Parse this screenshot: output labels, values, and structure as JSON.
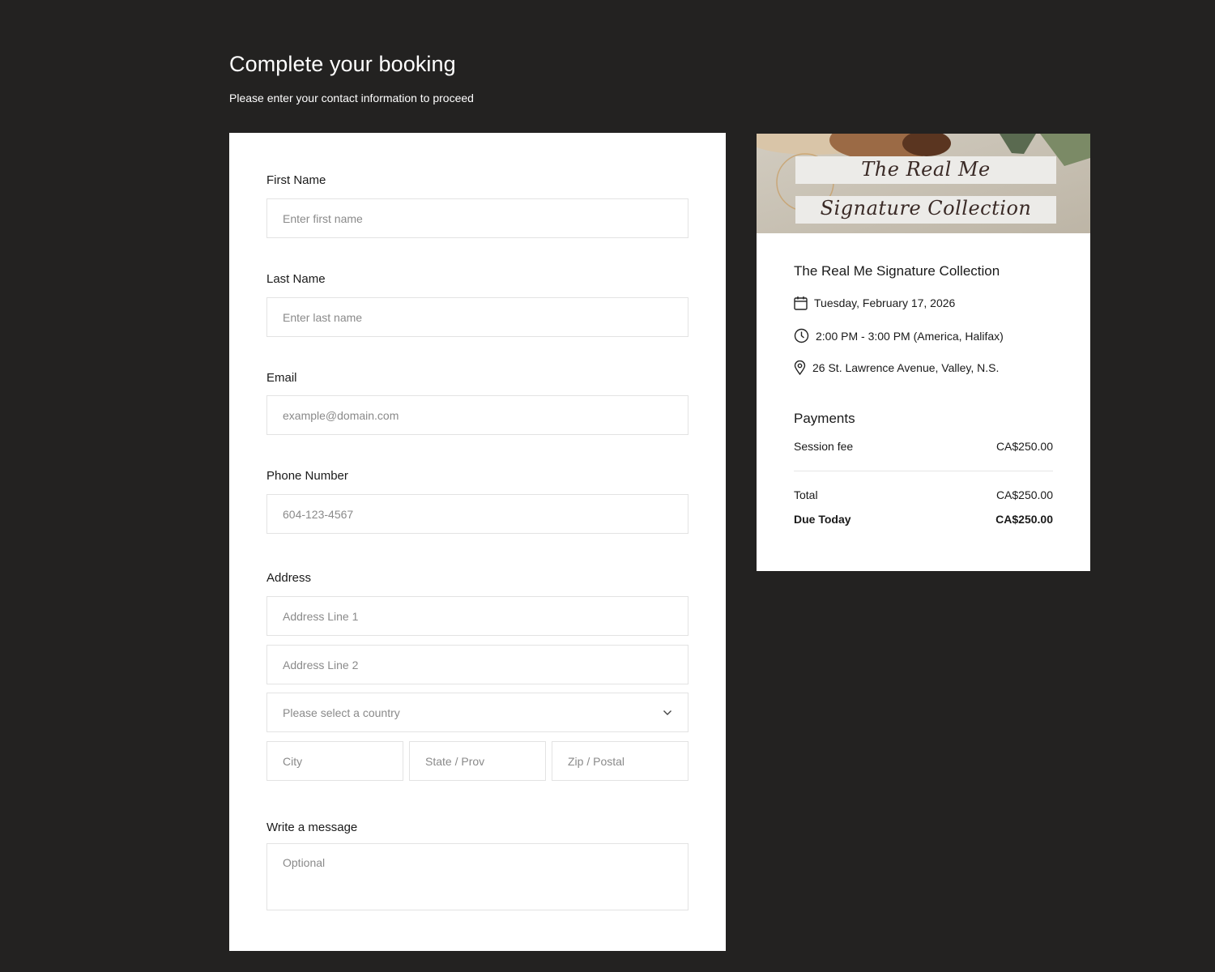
{
  "header": {
    "title": "Complete your booking",
    "subtitle": "Please enter your contact information to proceed"
  },
  "form": {
    "first_name": {
      "label": "First Name",
      "placeholder": "Enter first name",
      "value": ""
    },
    "last_name": {
      "label": "Last Name",
      "placeholder": "Enter last name",
      "value": ""
    },
    "email": {
      "label": "Email",
      "placeholder": "example@domain.com",
      "value": ""
    },
    "phone": {
      "label": "Phone Number",
      "placeholder": "604-123-4567",
      "value": ""
    },
    "address": {
      "label": "Address",
      "line1_placeholder": "Address Line 1",
      "line2_placeholder": "Address Line 2",
      "country_placeholder": "Please select a country",
      "city_placeholder": "City",
      "state_placeholder": "State / Prov",
      "zip_placeholder": "Zip / Postal"
    },
    "message": {
      "label": "Write a message",
      "placeholder": "Optional"
    }
  },
  "summary": {
    "banner_lines": [
      "The Real Me",
      "Signature Collection"
    ],
    "event_title": "The Real Me Signature Collection",
    "date": "Tuesday, February 17, 2026",
    "time": "2:00 PM - 3:00 PM (America, Halifax)",
    "location": "26 St. Lawrence Avenue, Valley, N.S.",
    "icons": {
      "date": "calendar-icon",
      "time": "clock-icon",
      "location": "map-pin-icon",
      "select": "chevron-down-icon"
    },
    "payments": {
      "title": "Payments",
      "items": [
        {
          "label": "Session fee",
          "amount": "CA$250.00"
        }
      ],
      "total_label": "Total",
      "total_amount": "CA$250.00",
      "due_label": "Due Today",
      "due_amount": "CA$250.00"
    }
  },
  "colors": {
    "background": "#232221",
    "card": "#ffffff",
    "input_border": "#e3e3e3",
    "placeholder": "#8a8a8a",
    "banner_bg": "#cbc4b7",
    "banner_strip": "#ecebe8",
    "banner_text": "#3a2a26"
  }
}
